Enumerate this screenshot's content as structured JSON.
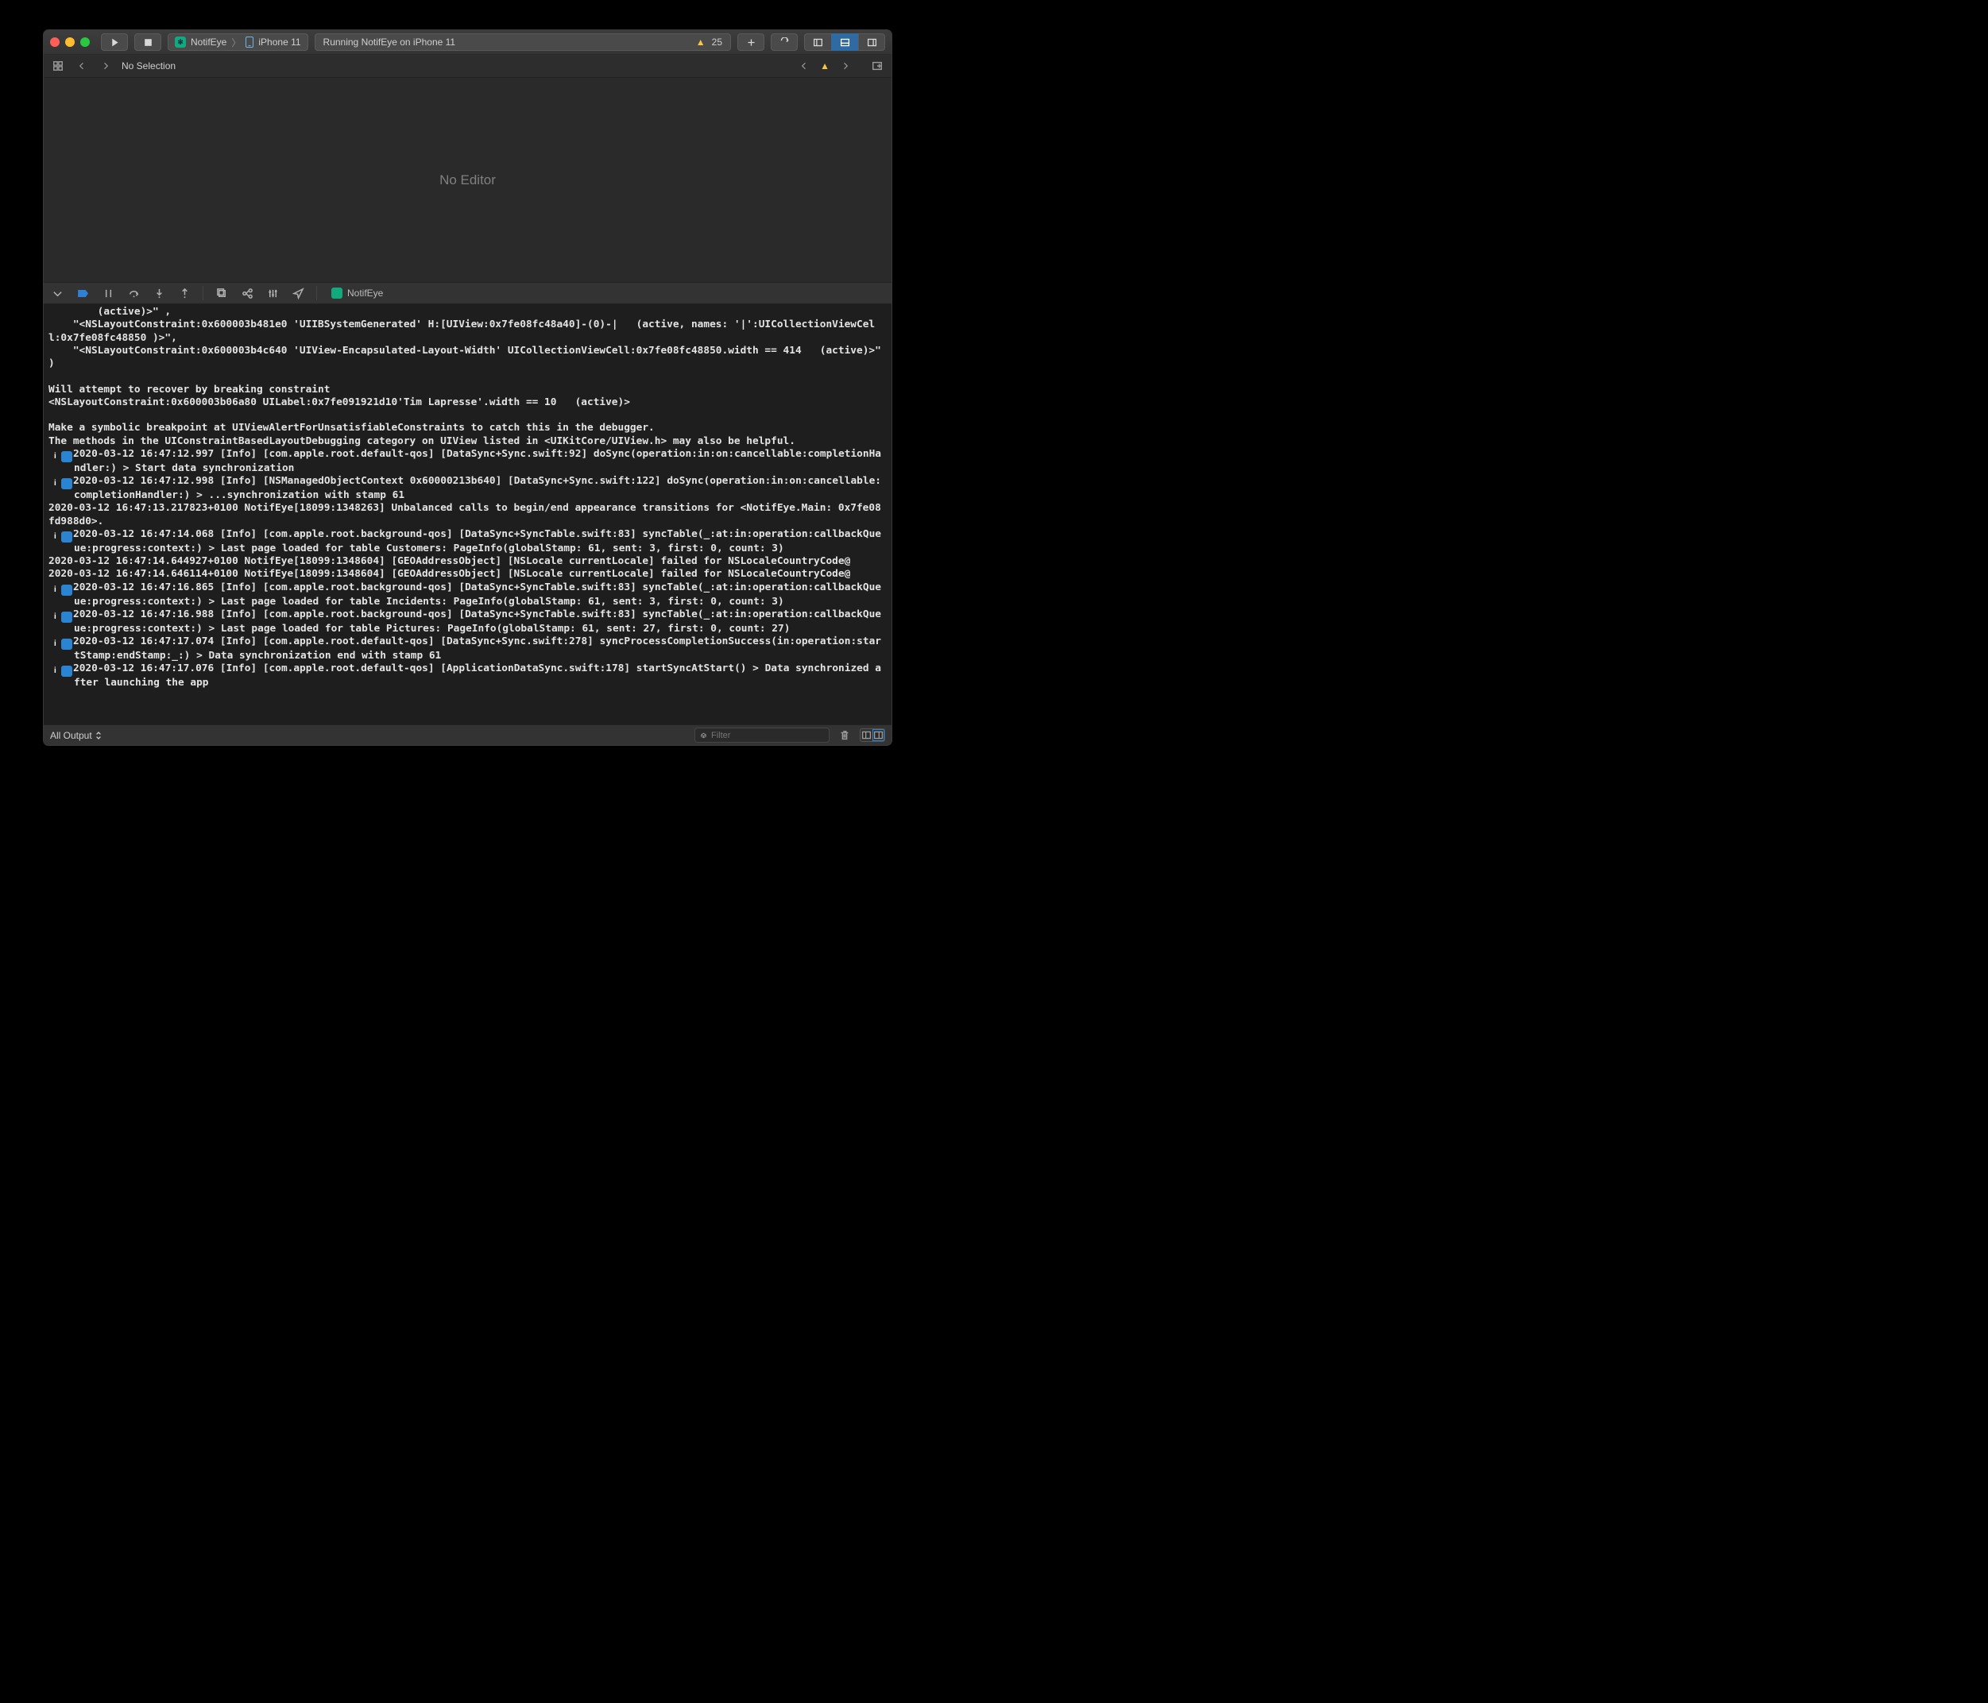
{
  "titlebar": {
    "scheme_project": "NotifEye",
    "scheme_target": "iPhone 11",
    "status_text": "Running NotifEye on iPhone 11",
    "warning_count": "25"
  },
  "tabbar": {
    "selection_text": "No Selection"
  },
  "editor": {
    "placeholder": "No Editor"
  },
  "dbgbar": {
    "project": "NotifEye"
  },
  "console": {
    "lines": [
      {
        "text": "        (active)>\" ,"
      },
      {
        "text": "    \"<NSLayoutConstraint:0x600003b481e0 'UIIBSystemGenerated' H:[UIView:0x7fe08fc48a40]-(0)-|   (active, names: '|':UICollectionViewCell:0x7fe08fc48850 )>\","
      },
      {
        "text": "    \"<NSLayoutConstraint:0x600003b4c640 'UIView-Encapsulated-Layout-Width' UICollectionViewCell:0x7fe08fc48850.width == 414   (active)>\""
      },
      {
        "text": ")"
      },
      {
        "text": " "
      },
      {
        "text": "Will attempt to recover by breaking constraint "
      },
      {
        "text": "<NSLayoutConstraint:0x600003b06a80 UILabel:0x7fe091921d10'Tim Lapresse'.width == 10   (active)>"
      },
      {
        "text": " "
      },
      {
        "text": "Make a symbolic breakpoint at UIViewAlertForUnsatisfiableConstraints to catch this in the debugger."
      },
      {
        "text": "The methods in the UIConstraintBasedLayoutDebugging category on UIView listed in <UIKitCore/UIView.h> may also be helpful."
      },
      {
        "badge": "i",
        "text": "2020-03-12 16:47:12.997 [Info] [com.apple.root.default-qos] [DataSync+Sync.swift:92] doSync(operation:in:on:cancellable:completionHandler:) > Start data synchronization"
      },
      {
        "badge": "i",
        "text": "2020-03-12 16:47:12.998 [Info] [NSManagedObjectContext 0x60000213b640] [DataSync+Sync.swift:122] doSync(operation:in:on:cancellable:completionHandler:) > ...synchronization with stamp 61"
      },
      {
        "text": "2020-03-12 16:47:13.217823+0100 NotifEye[18099:1348263] Unbalanced calls to begin/end appearance transitions for <NotifEye.Main: 0x7fe08fd988d0>."
      },
      {
        "badge": "i",
        "text": "2020-03-12 16:47:14.068 [Info] [com.apple.root.background-qos] [DataSync+SyncTable.swift:83] syncTable(_:at:in:operation:callbackQueue:progress:context:) > Last page loaded for table Customers: PageInfo(globalStamp: 61, sent: 3, first: 0, count: 3)"
      },
      {
        "text": "2020-03-12 16:47:14.644927+0100 NotifEye[18099:1348604] [GEOAddressObject] [NSLocale currentLocale] failed for NSLocaleCountryCode@"
      },
      {
        "text": "2020-03-12 16:47:14.646114+0100 NotifEye[18099:1348604] [GEOAddressObject] [NSLocale currentLocale] failed for NSLocaleCountryCode@"
      },
      {
        "badge": "i",
        "text": "2020-03-12 16:47:16.865 [Info] [com.apple.root.background-qos] [DataSync+SyncTable.swift:83] syncTable(_:at:in:operation:callbackQueue:progress:context:) > Last page loaded for table Incidents: PageInfo(globalStamp: 61, sent: 3, first: 0, count: 3)"
      },
      {
        "badge": "i",
        "text": "2020-03-12 16:47:16.988 [Info] [com.apple.root.background-qos] [DataSync+SyncTable.swift:83] syncTable(_:at:in:operation:callbackQueue:progress:context:) > Last page loaded for table Pictures: PageInfo(globalStamp: 61, sent: 27, first: 0, count: 27)"
      },
      {
        "badge": "i",
        "text": "2020-03-12 16:47:17.074 [Info] [com.apple.root.default-qos] [DataSync+Sync.swift:278] syncProcessCompletionSuccess(in:operation:startStamp:endStamp:_:) > Data synchronization end with stamp 61"
      },
      {
        "badge": "i",
        "text": "2020-03-12 16:47:17.076 [Info] [com.apple.root.default-qos] [ApplicationDataSync.swift:178] startSyncAtStart() > Data synchronized after launching the app"
      }
    ]
  },
  "bottombar": {
    "output_scope": "All Output",
    "filter_placeholder": "Filter"
  }
}
